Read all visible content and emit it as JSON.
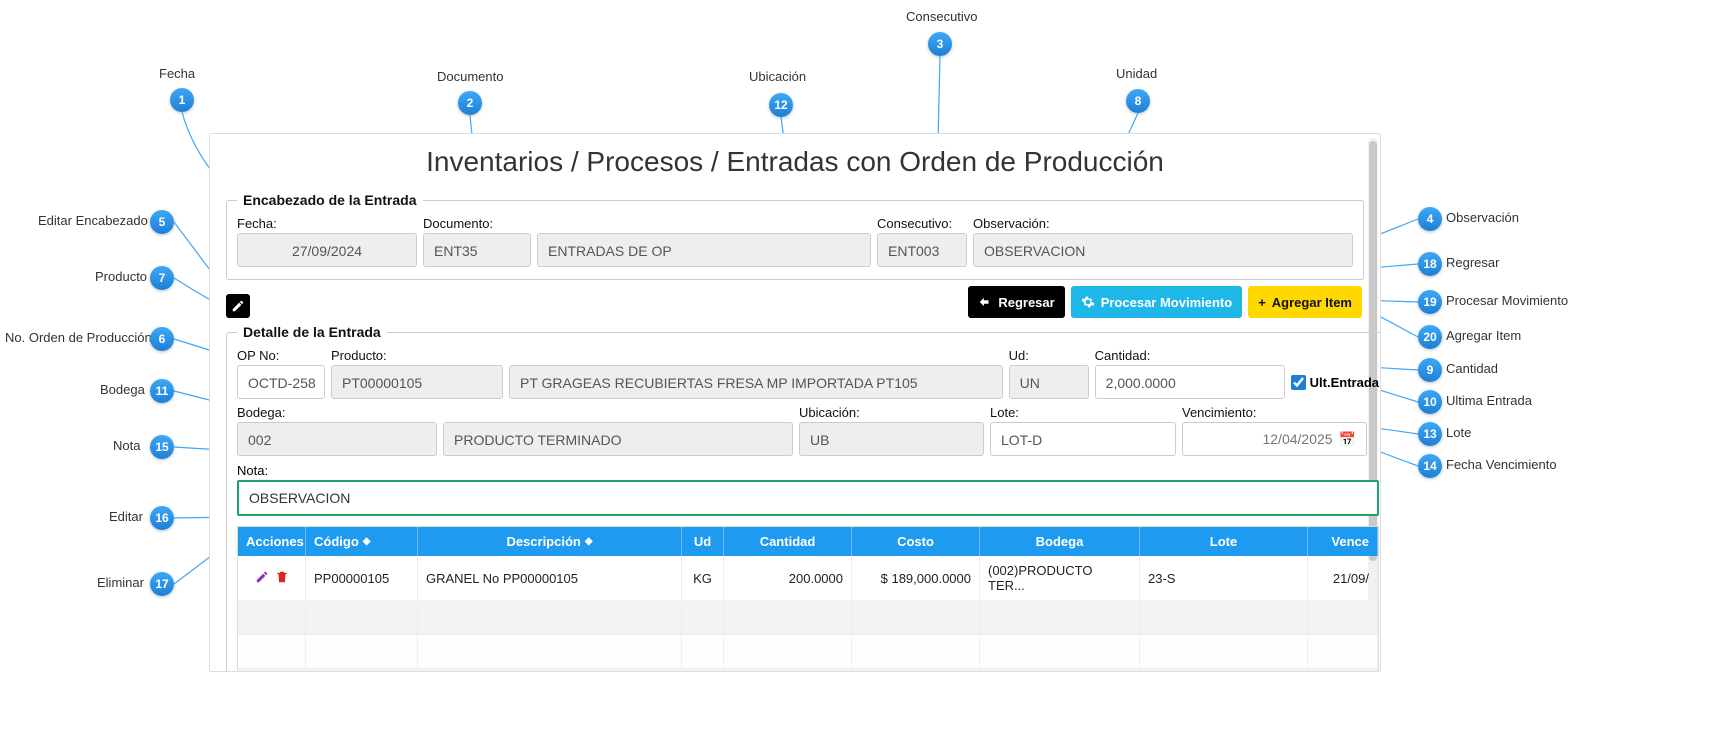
{
  "callouts": {
    "l1": "Fecha",
    "l2": "Documento",
    "l3": "Consecutivo",
    "l4": "Observación",
    "l5": "Editar Encabezado",
    "l6": "No. Orden de Producción",
    "l7": "Producto",
    "l8": "Unidad",
    "l9": "Cantidad",
    "l10": "Ultima Entrada",
    "l11": "Bodega",
    "l12": "Ubicación",
    "l13": "Lote",
    "l14": "Fecha Vencimiento",
    "l15": "Nota",
    "l16": "Editar",
    "l17": "Eliminar",
    "l18": "Regresar",
    "l19": "Procesar Movimiento",
    "l20": "Agregar Item"
  },
  "title": "Inventarios / Procesos / Entradas con Orden de Producción",
  "header": {
    "legend": "Encabezado de la Entrada",
    "fecha_label": "Fecha:",
    "fecha_val": "27/09/2024",
    "doc_label": "Documento:",
    "doc_code": "ENT35",
    "doc_desc": "ENTRADAS DE OP",
    "cons_label": "Consecutivo:",
    "cons_val": "ENT003",
    "obs_label": "Observación:",
    "obs_val": "OBSERVACION"
  },
  "actions": {
    "regresar": "Regresar",
    "procesar": "Procesar Movimiento",
    "agregar": "Agregar Item"
  },
  "detail": {
    "legend": "Detalle de la Entrada",
    "op_label": "OP No:",
    "op_val": "OCTD-258",
    "prod_label": "Producto:",
    "prod_code": "PT00000105",
    "prod_desc": "PT GRAGEAS RECUBIERTAS FRESA  MP IMPORTADA PT105",
    "ud_label": "Ud:",
    "ud_val": "UN",
    "cant_label": "Cantidad:",
    "cant_val": "2,000.0000",
    "ult_label": "Ult.Entrada",
    "bodega_label": "Bodega:",
    "bodega_code": "002",
    "bodega_desc": "PRODUCTO TERMINADO",
    "ubi_label": "Ubicación:",
    "ubi_val": "UB",
    "lote_label": "Lote:",
    "lote_val": "LOT-D",
    "venc_label": "Vencimiento:",
    "venc_val": "12/04/2025",
    "nota_label": "Nota:",
    "nota_val": "OBSERVACION"
  },
  "table": {
    "h_acc": "Acciones",
    "h_cod": "Código",
    "h_des": "Descripción",
    "h_ud": "Ud",
    "h_qty": "Cantidad",
    "h_cost": "Costo",
    "h_bod": "Bodega",
    "h_lot": "Lote",
    "h_ven": "Vence",
    "row": {
      "cod": "PP00000105",
      "des": "GRANEL No PP00000105",
      "ud": "KG",
      "qty": "200.0000",
      "cost": "$ 189,000.0000",
      "bod": "(002)PRODUCTO TER...",
      "lot": "23-S",
      "ven": "21/09/"
    }
  }
}
